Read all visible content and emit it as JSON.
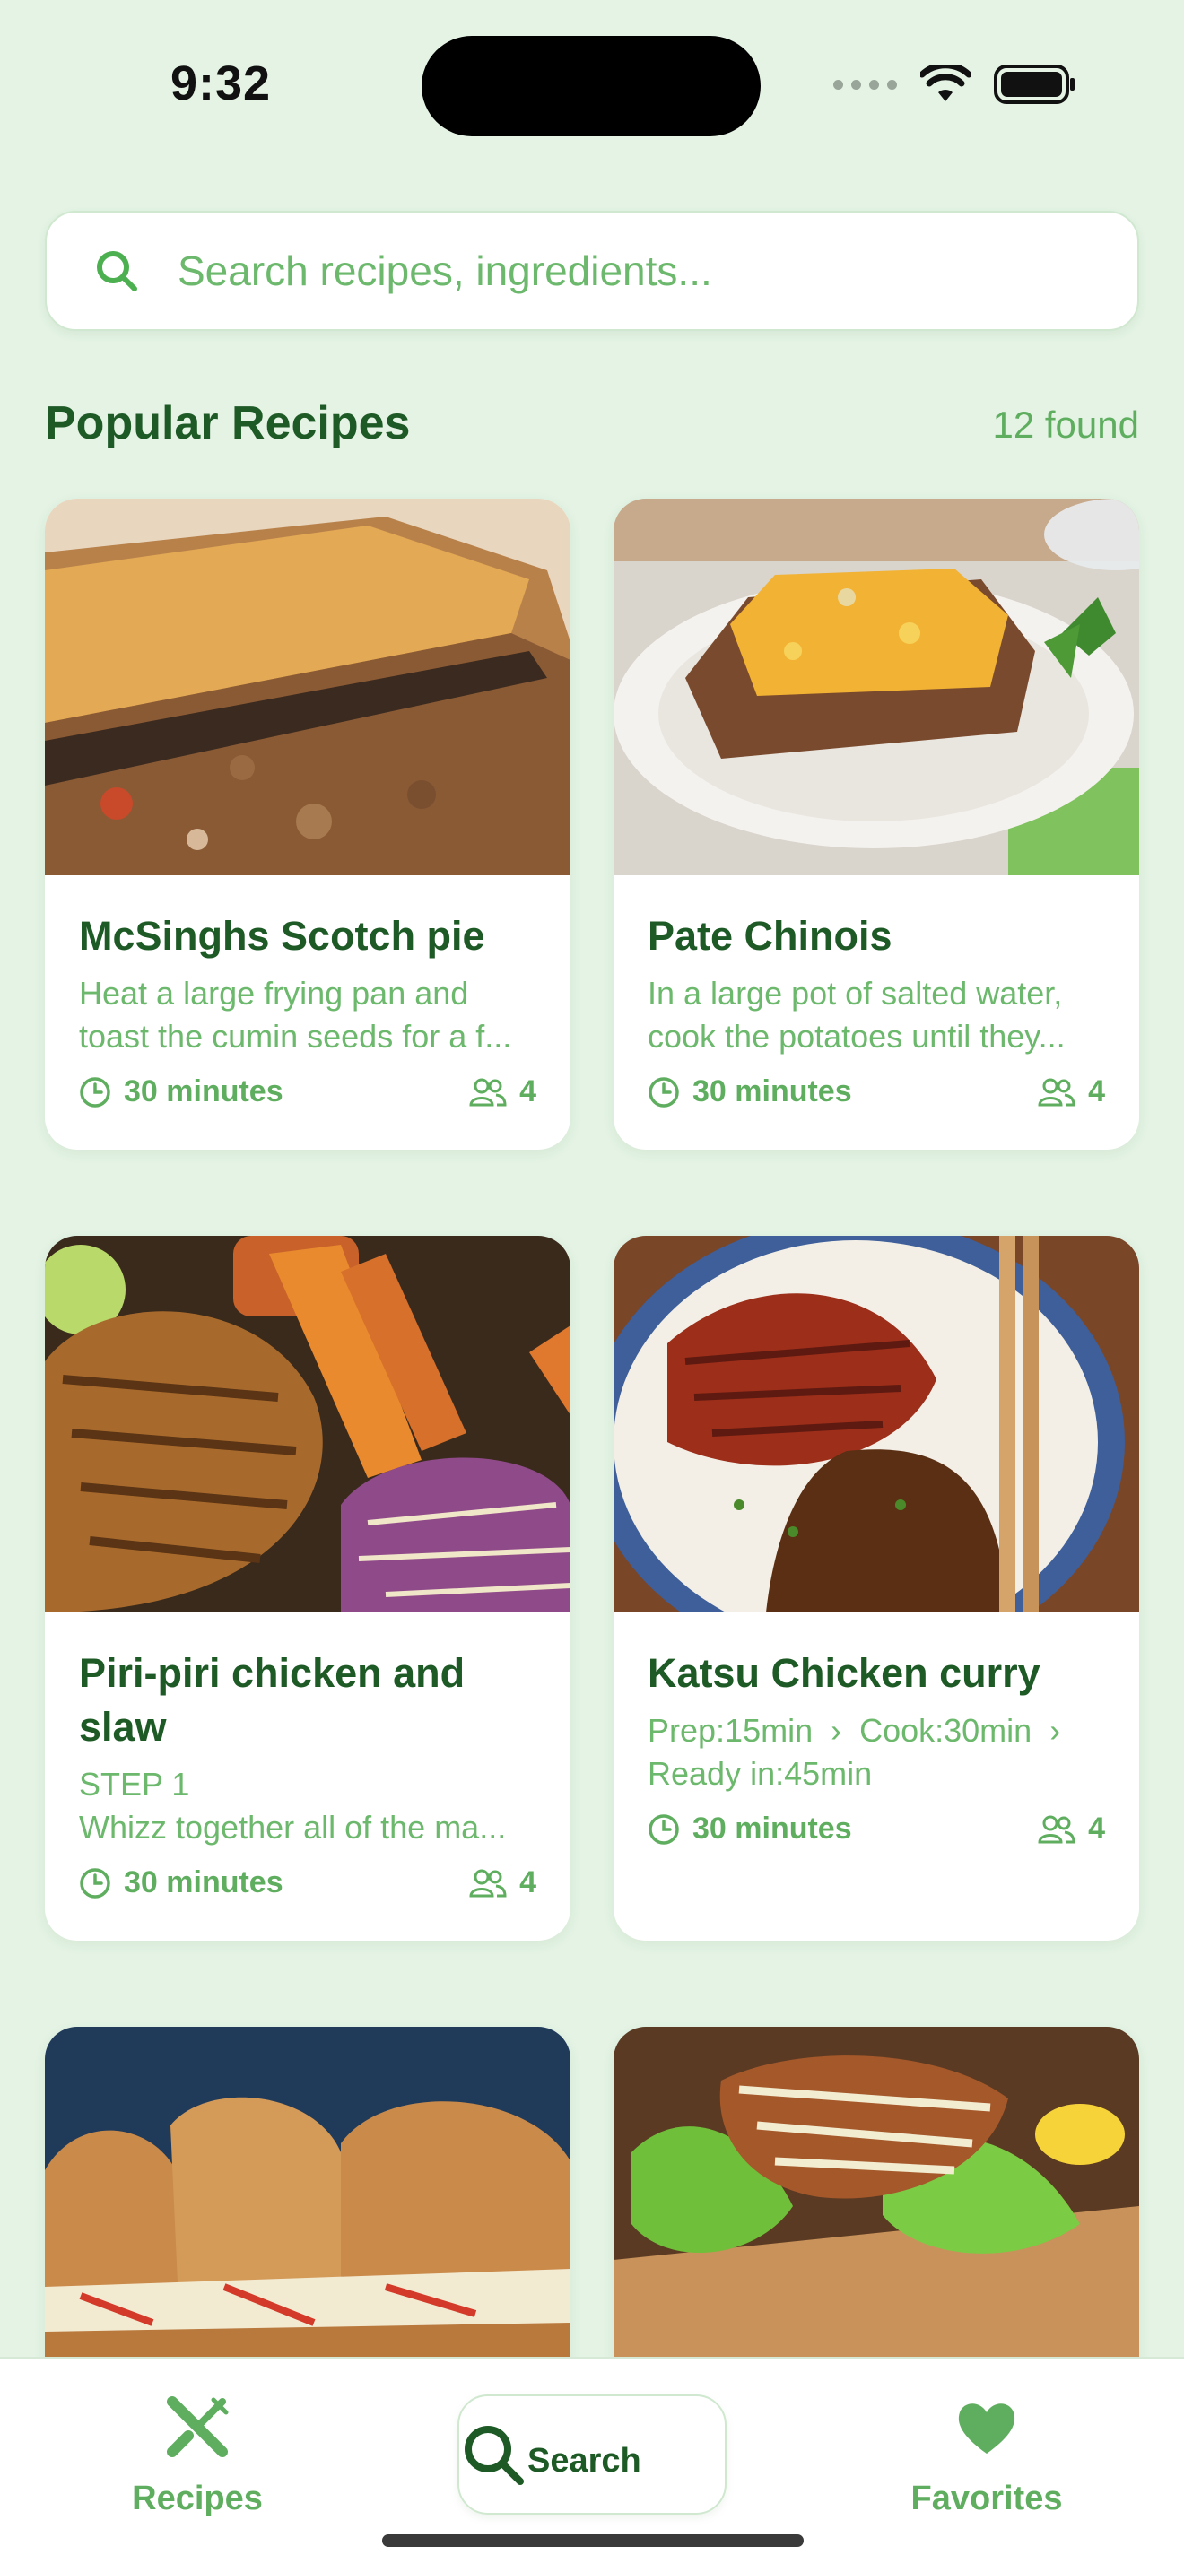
{
  "status_bar": {
    "time": "9:32"
  },
  "search": {
    "placeholder": "Search recipes, ingredients..."
  },
  "section": {
    "title": "Popular Recipes",
    "count_label": "12 found"
  },
  "recipes": [
    {
      "title": "McSinghs Scotch pie",
      "desc_line1": "Heat a large frying pan and",
      "desc_line2": "toast the cumin seeds for a f...",
      "time": "30 minutes",
      "servings": "4"
    },
    {
      "title": "Pate Chinois",
      "desc_line1": "In a large pot of salted water,",
      "desc_line2": "cook the potatoes until they...",
      "time": "30 minutes",
      "servings": "4"
    },
    {
      "title_line1": "Piri-piri chicken and",
      "title_line2": "slaw",
      "desc_line1": "STEP 1",
      "desc_line2": "Whizz together all of the ma...",
      "time": "30 minutes",
      "servings": "4"
    },
    {
      "title": "Katsu Chicken curry",
      "desc_line1": "Prep:15min  ›  Cook:30min  ›",
      "desc_line2": "Ready in:45min",
      "time": "30 minutes",
      "servings": "4"
    }
  ],
  "tabs": [
    {
      "label": "Recipes",
      "icon": "fork-knife-icon"
    },
    {
      "label": "Search",
      "icon": "search-icon"
    },
    {
      "label": "Favorites",
      "icon": "heart-icon"
    }
  ],
  "colors": {
    "background": "#e4f3e4",
    "primary": "#1e5a26",
    "accent": "#5fae5f"
  }
}
